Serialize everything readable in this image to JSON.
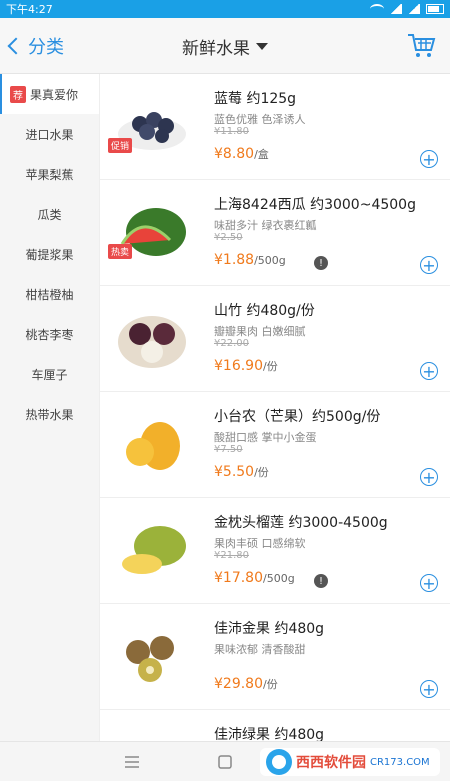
{
  "status": {
    "time": "下午4:27"
  },
  "header": {
    "back_label": "分类",
    "title": "新鲜水果"
  },
  "sidebar": {
    "items": [
      {
        "badge": "荐",
        "label": "果真爱你",
        "active": true
      },
      {
        "label": "进口水果"
      },
      {
        "label": "苹果梨蕉"
      },
      {
        "label": "瓜类"
      },
      {
        "label": "葡提浆果"
      },
      {
        "label": "柑桔橙柚"
      },
      {
        "label": "桃杏李枣"
      },
      {
        "label": "车厘子"
      },
      {
        "label": "热带水果"
      }
    ]
  },
  "products": [
    {
      "name": "蓝莓 约125g",
      "desc": "蓝色优雅 色泽诱人",
      "old_price": "¥11.80",
      "price": "¥8.80",
      "unit": "/盒",
      "tag": "促销",
      "img": "blueberry-image"
    },
    {
      "name": "上海8424西瓜 约3000~4500g",
      "desc": "味甜多汁 绿衣裹红瓤",
      "old_price": "¥2.50",
      "price": "¥1.88",
      "unit": "/500g",
      "tag": "热卖",
      "info": true,
      "img": "watermelon-image"
    },
    {
      "name": "山竹 约480g/份",
      "desc": "瓣瓣果肉 白嫩细腻",
      "old_price": "¥22.00",
      "price": "¥16.90",
      "unit": "/份",
      "img": "mangosteen-image"
    },
    {
      "name": "小台农（芒果）约500g/份",
      "desc": "酸甜口感 掌中小金蛋",
      "old_price": "¥7.50",
      "price": "¥5.50",
      "unit": "/份",
      "img": "mango-image"
    },
    {
      "name": "金枕头榴莲 约3000-4500g",
      "desc": "果肉丰硕 口感绵软",
      "old_price": "¥21.80",
      "price": "¥17.80",
      "unit": "/500g",
      "info": true,
      "img": "durian-image"
    },
    {
      "name": "佳沛金果 约480g",
      "desc": "果味浓郁 清香酸甜",
      "old_price": "",
      "price": "¥29.80",
      "unit": "/份",
      "img": "kiwi-gold-image"
    },
    {
      "name": "佳沛绿果 约480g",
      "desc": "",
      "old_price": "",
      "price": "",
      "unit": "",
      "img": "kiwi-green-image"
    }
  ],
  "watermark": {
    "text": "西西软件园",
    "sub": "CR173.COM"
  },
  "colors": {
    "accent": "#2a8fe0",
    "price": "#f07a1c",
    "tag": "#e94a4a"
  }
}
